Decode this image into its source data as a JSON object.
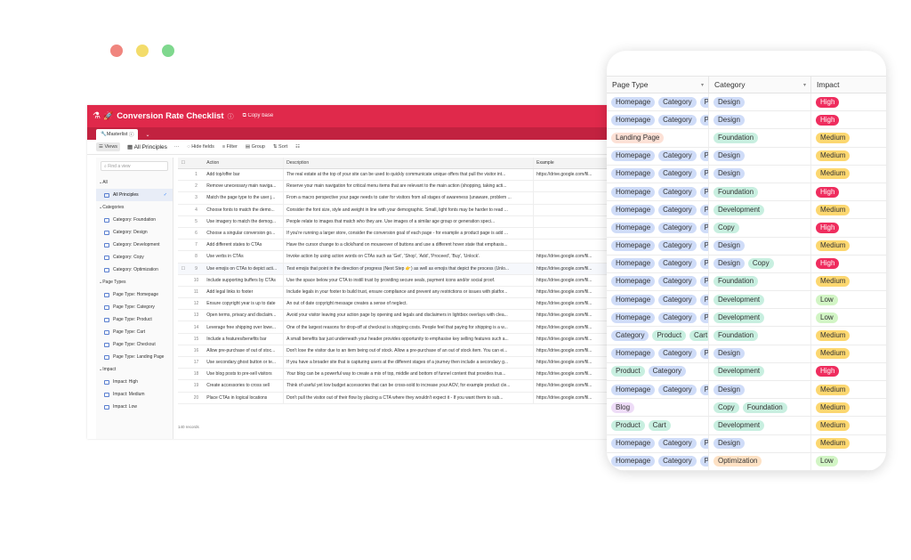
{
  "app": {
    "title": "Conversion Rate Checklist",
    "copy_base": "Copy base",
    "tab": "Masterlist",
    "views_label": "Views",
    "current_view": "All Principles",
    "toolbar": {
      "more": "···",
      "hide": "Hide fields",
      "filter": "Filter",
      "group": "Group",
      "sort": "Sort"
    },
    "find_placeholder": "Find a view",
    "sidebar": [
      {
        "kind": "group",
        "label": "All"
      },
      {
        "kind": "item",
        "label": "All Principles",
        "selected": true
      },
      {
        "kind": "group",
        "label": "Categories"
      },
      {
        "kind": "item",
        "label": "Category: Foundation"
      },
      {
        "kind": "item",
        "label": "Category: Design"
      },
      {
        "kind": "item",
        "label": "Category: Development"
      },
      {
        "kind": "item",
        "label": "Category: Copy"
      },
      {
        "kind": "item",
        "label": "Category: Optimization"
      },
      {
        "kind": "group",
        "label": "Page Types"
      },
      {
        "kind": "item",
        "label": "Page Type: Homepage"
      },
      {
        "kind": "item",
        "label": "Page Type: Category"
      },
      {
        "kind": "item",
        "label": "Page Type: Product"
      },
      {
        "kind": "item",
        "label": "Page Type: Cart"
      },
      {
        "kind": "item",
        "label": "Page Type: Checkout"
      },
      {
        "kind": "item",
        "label": "Page Type: Landing Page"
      },
      {
        "kind": "group",
        "label": "Impact"
      },
      {
        "kind": "item",
        "label": "Impact: High"
      },
      {
        "kind": "item",
        "label": "Impact: Medium"
      },
      {
        "kind": "item",
        "label": "Impact: Low"
      }
    ],
    "columns": [
      "Action",
      "Description",
      "Example"
    ],
    "rows": [
      {
        "n": "1",
        "action": "Add top/offer bar",
        "desc": "The real estate at the top of your site can be used to quickly communicate unique offers that pull the visitor int...",
        "ex": "https://drive.google.com/fil..."
      },
      {
        "n": "2",
        "action": "Remove unecessary main naviga...",
        "desc": "Reserve your main navigation for critical menu items that are relevant to the main action (shopping, taking acti...",
        "ex": ""
      },
      {
        "n": "3",
        "action": "Match the page type to the user j...",
        "desc": "From a macro perspective your page needs to cater for visitors from all stages of awareness (unaware, problem ...",
        "ex": ""
      },
      {
        "n": "4",
        "action": "Choose fonts to match the demo...",
        "desc": "Consider the font size, style and weight in line with your demographic. Small, light fonts may be harder to read ...",
        "ex": ""
      },
      {
        "n": "5",
        "action": "Use imagery to match the demog...",
        "desc": "People relate to images that match who they are. Use images of a similar age group or generation speci...",
        "ex": ""
      },
      {
        "n": "6",
        "action": "Choose a singular conversion go...",
        "desc": "If you're running a larger store, consider the conversion goal of each page - for example a product page is add ...",
        "ex": ""
      },
      {
        "n": "7",
        "action": "Add different states to CTAs",
        "desc": "Have the cursor change to a click/hand on mouseover of buttons and use a different hover state that emphasis...",
        "ex": ""
      },
      {
        "n": "8",
        "action": "Use verbs in CTAs",
        "desc": "Invoke action by using action words on CTAs such as 'Get', 'Shop', 'Add', 'Proceed', 'Buy', 'Unlock'.",
        "ex": "https://drive.google.com/fil..."
      },
      {
        "n": "9",
        "action": "Use emojis on CTAs to depict acti...",
        "desc": "Test emojis that point in the direction of progress (Next Step 👉) as well as emojis that depict the process (Unlo...",
        "ex": "https://drive.google.com/fil..."
      },
      {
        "n": "10",
        "action": "Include supporting buffers by CTAs",
        "desc": "Use the space below your CTA to instill trust by providing secure seals, payment icons and/or social proof.",
        "ex": "https://drive.google.com/fil..."
      },
      {
        "n": "11",
        "action": "Add legal links to footer",
        "desc": "Include legals in your footer to build trust, ensure compliance and prevent any restrictions or issues with platfor...",
        "ex": "https://drive.google.com/fil..."
      },
      {
        "n": "12",
        "action": "Ensure copyright year is up to date",
        "desc": "An out of date copyright message creates a sense of neglect.",
        "ex": "https://drive.google.com/fil..."
      },
      {
        "n": "13",
        "action": "Open terms, privacy and disclaim...",
        "desc": "Avoid your visitor leaving your action page by opening and legals and disclaimers in lightbox overlays with clea...",
        "ex": "https://drive.google.com/fil..."
      },
      {
        "n": "14",
        "action": "Leverage free shipping over lowe...",
        "desc": "One of the largest reasons for drop-off at checkout is shipping costs. People feel that paying for shipping is a w...",
        "ex": "https://drive.google.com/fil..."
      },
      {
        "n": "15",
        "action": "Include a features/benefits bar",
        "desc": "A small benefits bar just underneath your header provides opportunity to emphasise key selling features such a...",
        "ex": "https://drive.google.com/fil..."
      },
      {
        "n": "16",
        "action": "Allow pre-purchase of out of stoc...",
        "desc": "Don't lose the visitor due to an item being out of stock. Allow a pre-purchase of an out of stock item. You can ei...",
        "ex": "https://drive.google.com/fil..."
      },
      {
        "n": "17",
        "action": "Use secondary ghost button or te...",
        "desc": "If you have a broader site that is capturing users at the different stages of a journey then include a secondary g...",
        "ex": "https://drive.google.com/fil..."
      },
      {
        "n": "18",
        "action": "Use blog posts to pre-sell visitors",
        "desc": "Your blog can be a powerful way to create a mix of top, middle and bottom of funnel content that provides trus...",
        "ex": "https://drive.google.com/fil..."
      },
      {
        "n": "19",
        "action": "Create accessories to cross sell",
        "desc": "Think of useful yet low budget accessories that can be cross-sold to increase your AOV, for example product cle...",
        "ex": "https://drive.google.com/fil..."
      },
      {
        "n": "20",
        "action": "Place CTAs in logical locations",
        "desc": "Don't pull the visitor out of their flow by placing a CTA where they wouldn't expect it - If you want them to sub...",
        "ex": "https://drive.google.com/fil..."
      }
    ],
    "record_count": "140 records"
  },
  "card": {
    "headers": [
      "Page Type",
      "Category",
      "Impact"
    ],
    "rows": [
      {
        "pt": [
          "Homepage",
          "Category",
          "Pr"
        ],
        "cat": [
          "Design"
        ],
        "imp": "High"
      },
      {
        "pt": [
          "Homepage",
          "Category",
          "Pr"
        ],
        "cat": [
          "Design"
        ],
        "imp": "High"
      },
      {
        "pt": [
          "Landing Page"
        ],
        "cat": [
          "Foundation"
        ],
        "imp": "Medium"
      },
      {
        "pt": [
          "Homepage",
          "Category",
          "Pr"
        ],
        "cat": [
          "Design"
        ],
        "imp": "Medium"
      },
      {
        "pt": [
          "Homepage",
          "Category",
          "Pr"
        ],
        "cat": [
          "Design"
        ],
        "imp": "Medium"
      },
      {
        "pt": [
          "Homepage",
          "Category",
          "Pr"
        ],
        "cat": [
          "Foundation"
        ],
        "imp": "High"
      },
      {
        "pt": [
          "Homepage",
          "Category",
          "Pr"
        ],
        "cat": [
          "Development"
        ],
        "imp": "Medium"
      },
      {
        "pt": [
          "Homepage",
          "Category",
          "Pr"
        ],
        "cat": [
          "Copy"
        ],
        "imp": "High"
      },
      {
        "pt": [
          "Homepage",
          "Category",
          "Pr"
        ],
        "cat": [
          "Design"
        ],
        "imp": "Medium"
      },
      {
        "pt": [
          "Homepage",
          "Category",
          "Pr"
        ],
        "cat": [
          "Design",
          "Copy"
        ],
        "imp": "High"
      },
      {
        "pt": [
          "Homepage",
          "Category",
          "Pr"
        ],
        "cat": [
          "Foundation"
        ],
        "imp": "Medium"
      },
      {
        "pt": [
          "Homepage",
          "Category",
          "Pr"
        ],
        "cat": [
          "Development"
        ],
        "imp": "Low"
      },
      {
        "pt": [
          "Homepage",
          "Category",
          "Pr"
        ],
        "cat": [
          "Development"
        ],
        "imp": "Low"
      },
      {
        "pt": [
          "Category",
          "Product",
          "Cart"
        ],
        "cat": [
          "Foundation"
        ],
        "imp": "Medium"
      },
      {
        "pt": [
          "Homepage",
          "Category",
          "Pr"
        ],
        "cat": [
          "Design"
        ],
        "imp": "Medium"
      },
      {
        "pt": [
          "Product",
          "Category"
        ],
        "cat": [
          "Development"
        ],
        "imp": "High"
      },
      {
        "pt": [
          "Homepage",
          "Category",
          "Pr"
        ],
        "cat": [
          "Design"
        ],
        "imp": "Medium"
      },
      {
        "pt": [
          "Blog"
        ],
        "cat": [
          "Copy",
          "Foundation"
        ],
        "imp": "Medium"
      },
      {
        "pt": [
          "Product",
          "Cart"
        ],
        "cat": [
          "Development"
        ],
        "imp": "Medium"
      },
      {
        "pt": [
          "Homepage",
          "Category",
          "Pr"
        ],
        "cat": [
          "Design"
        ],
        "imp": "Medium"
      },
      {
        "pt": [
          "Homepage",
          "Category",
          "Pr"
        ],
        "cat": [
          "Optimization"
        ],
        "imp": "Low"
      }
    ]
  },
  "colors": {
    "header": "#e0294b",
    "Homepage": "#cfdcf8",
    "Category": "#cfdcf8",
    "Pr": "#cfdcf8",
    "Product": "#c8efe0",
    "Cart": "#c8efe0",
    "Landing Page": "#fde1d6",
    "Blog": "#eedcf7",
    "Design": "#cfdcf8",
    "Foundation": "#c8efe0",
    "Development": "#c8efe0",
    "Copy": "#c8efe0",
    "Optimization": "#fde1c4",
    "High": "#ef2d5e",
    "Medium": "#fcd770",
    "Low": "#d2f5c5"
  }
}
